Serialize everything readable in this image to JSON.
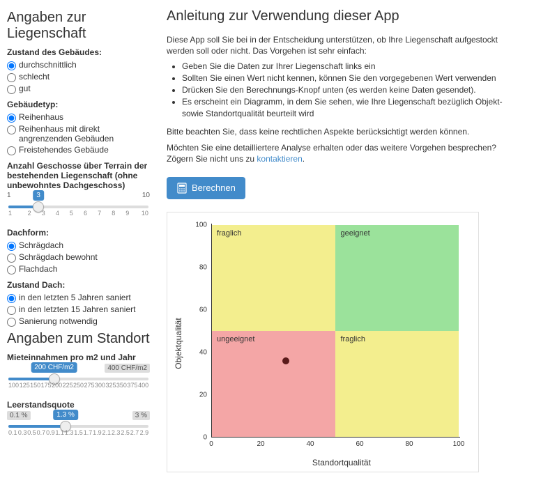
{
  "sidebar": {
    "section1_title": "Angaben zur Liegenschaft",
    "zustand": {
      "label": "Zustand des Gebäudes:",
      "options": [
        "durchschnittlich",
        "schlecht",
        "gut"
      ],
      "selected": 0
    },
    "typ": {
      "label": "Gebäudetyp:",
      "options": [
        "Reihenhaus",
        "Reihenhaus mit direkt angrenzenden Gebäuden",
        "Freistehendes Gebäude"
      ],
      "selected": 0
    },
    "geschosse": {
      "label": "Anzahl Geschosse über Terrain der bestehenden Liegenschaft (ohne unbewohntes Dachgeschoss)",
      "min_label": "1",
      "max_label": "10",
      "value_label": "3",
      "value_pct": 22,
      "ticks": [
        "1",
        "2",
        "3",
        "4",
        "5",
        "6",
        "7",
        "8",
        "9",
        "10"
      ]
    },
    "dachform": {
      "label": "Dachform:",
      "options": [
        "Schrägdach",
        "Schrägdach bewohnt",
        "Flachdach"
      ],
      "selected": 0
    },
    "zustand_dach": {
      "label": "Zustand Dach:",
      "options": [
        "in den letzten 5 Jahren saniert",
        "in den letzten 15 Jahren saniert",
        "Sanierung notwendig"
      ],
      "selected": 0
    },
    "section2_title": "Angaben zum Standort",
    "miete": {
      "label": "Mieteinnahmen pro m2 und Jahr",
      "value_label": "200 CHF/m2",
      "max_label": "400 CHF/m2",
      "value_pct": 33,
      "ticks": [
        "100",
        "125",
        "150",
        "175",
        "200",
        "225",
        "250",
        "275",
        "300",
        "325",
        "350",
        "375",
        "400"
      ]
    },
    "leerstand": {
      "label": "Leerstandsquote",
      "min_label": "0.1 %",
      "value_label": "1.3 %",
      "max_label": "3 %",
      "value_pct": 41,
      "ticks": [
        "0.1",
        "0.3",
        "0.5",
        "0.7",
        "0.9",
        "1.1",
        "1.3",
        "1.5",
        "1.7",
        "1.9",
        "2.1",
        "2.3",
        "2.5",
        "2.7",
        "2.9"
      ]
    }
  },
  "main": {
    "title": "Anleitung zur Verwendung dieser App",
    "intro": "Diese App soll Sie bei in der Entscheidung unterstützen, ob Ihre Liegenschaft aufgestockt werden soll oder nicht. Das Vorgehen ist sehr einfach:",
    "steps": [
      "Geben Sie die Daten zur Ihrer Liegenschaft links ein",
      "Sollten Sie einen Wert nicht kennen, können Sie den vorgegebenen Wert verwenden",
      "Drücken Sie den Berechnungs-Knopf unten (es werden keine Daten gesendet).",
      "Es erscheint ein Diagramm, in dem Sie sehen, wie Ihre Liegenschaft bezüglich Objekt- sowie Standortqualität beurteilt wird"
    ],
    "note": "Bitte beachten Sie, dass keine rechtlichen Aspekte berücksichtigt werden können.",
    "contact_pre": "Möchten Sie eine detailliertere Analyse erhalten oder das weitere Vorgehen besprechen? Zögern Sie nicht uns zu ",
    "contact_link": "kontaktieren",
    "contact_post": ".",
    "button_label": "Berechnen"
  },
  "chart_data": {
    "type": "scatter",
    "xlabel": "Standortqualität",
    "ylabel": "Objektqualität",
    "xlim": [
      0,
      100
    ],
    "ylim": [
      0,
      100
    ],
    "x_ticks": [
      0,
      20,
      40,
      60,
      80,
      100
    ],
    "y_ticks": [
      0,
      20,
      40,
      60,
      80,
      100
    ],
    "quadrants": [
      {
        "xmin": 0,
        "xmax": 50,
        "ymin": 50,
        "ymax": 100,
        "label": "fraglich",
        "color": "#f3ee8e"
      },
      {
        "xmin": 50,
        "xmax": 100,
        "ymin": 50,
        "ymax": 100,
        "label": "geeignet",
        "color": "#9be29b"
      },
      {
        "xmin": 0,
        "xmax": 50,
        "ymin": 0,
        "ymax": 50,
        "label": "ungeeignet",
        "color": "#f4a6a6"
      },
      {
        "xmin": 50,
        "xmax": 100,
        "ymin": 0,
        "ymax": 50,
        "label": "fraglich",
        "color": "#f3ee8e"
      }
    ],
    "points": [
      {
        "x": 30,
        "y": 36
      }
    ]
  }
}
